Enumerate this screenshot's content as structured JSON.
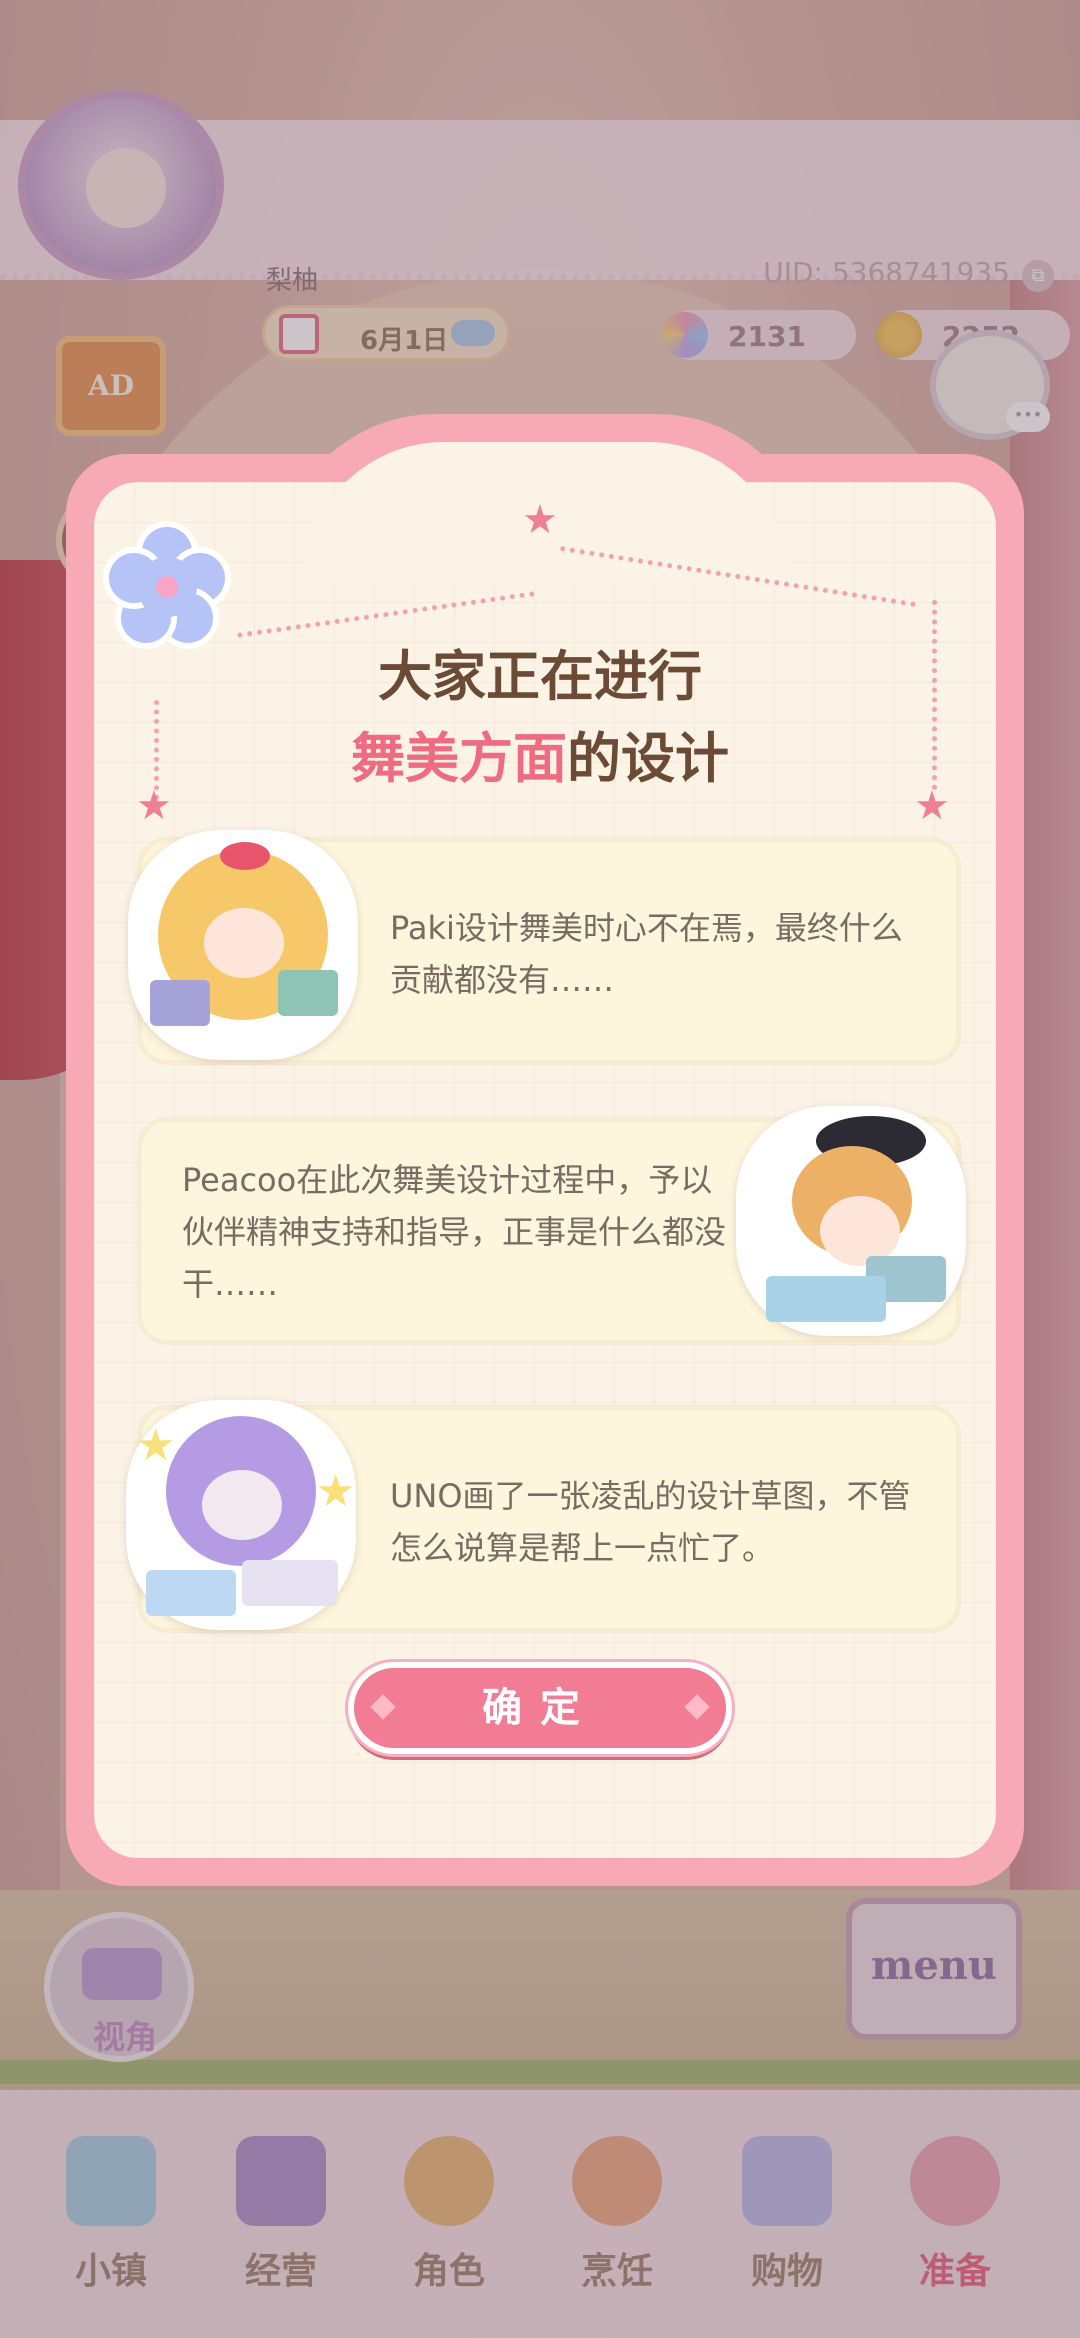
{
  "header": {
    "player_name": "梨柚",
    "date": "6月1日",
    "uid": "UID: 5368741935",
    "gems": "2131",
    "coins": "2252",
    "ad_label": "AD"
  },
  "dialog": {
    "title_line1": "大家正在进行",
    "title_highlight": "舞美方面",
    "title_rest": "的设计",
    "cards": [
      {
        "character": "Paki",
        "text": "Paki设计舞美时心不在焉，最终什么贡献都没有……"
      },
      {
        "character": "Peacoo",
        "text": "Peacoo在此次舞美设计过程中，予以伙伴精神支持和指导，正事是什么都没干……"
      },
      {
        "character": "UNO",
        "text": "UNO画了一张凌乱的设计草图，不管怎么说算是帮上一点忙了。"
      }
    ],
    "confirm_label": "确定"
  },
  "controls": {
    "view_label": "视角",
    "menu_label": "menu"
  },
  "bottom_nav": {
    "items": [
      {
        "label": "小镇",
        "icon": "map-icon"
      },
      {
        "label": "经营",
        "icon": "shop-bag-icon"
      },
      {
        "label": "角色",
        "icon": "character-icon"
      },
      {
        "label": "烹饪",
        "icon": "sandwich-icon"
      },
      {
        "label": "购物",
        "icon": "shopping-bag-icon"
      },
      {
        "label": "准备",
        "icon": "cake-hat-icon"
      }
    ],
    "active_index": 5
  },
  "colors": {
    "accent_pink": "#f17c93",
    "title_brown": "#6b4a36",
    "highlight_pink": "#ee6b83",
    "card_bg": "#fdf6dc"
  }
}
